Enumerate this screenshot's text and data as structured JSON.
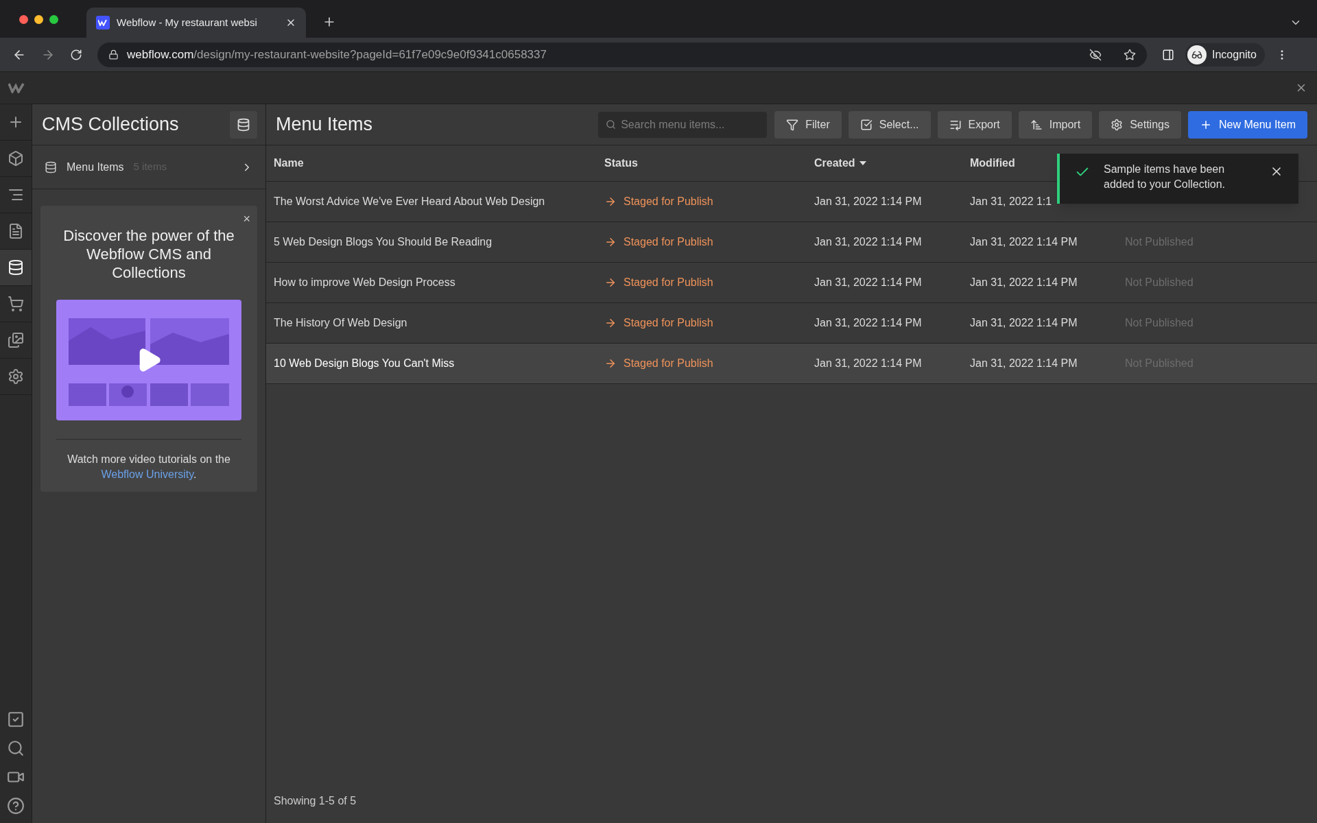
{
  "browser": {
    "tab_title": "Webflow - My restaurant websi",
    "url_host": "webflow.com",
    "url_path": "/design/my-restaurant-website?pageId=61f7e09c9e0f9341c0658337",
    "profile": "Incognito"
  },
  "rail": [
    {
      "kind": "add",
      "selected": false
    },
    {
      "kind": "box",
      "selected": false
    },
    {
      "kind": "navigator",
      "selected": false
    },
    {
      "kind": "pages",
      "selected": false
    },
    {
      "kind": "cms",
      "selected": true
    },
    {
      "kind": "cart",
      "selected": false
    },
    {
      "kind": "assets",
      "selected": false
    },
    {
      "kind": "settings",
      "selected": false
    }
  ],
  "rail_bottom": [
    {
      "kind": "check"
    },
    {
      "kind": "search"
    },
    {
      "kind": "video"
    },
    {
      "kind": "help"
    }
  ],
  "panel": {
    "title": "CMS Collections",
    "collections": [
      {
        "name": "Menu Items",
        "count": "5 items"
      }
    ],
    "promo": {
      "close": "×",
      "heading": "Discover the power of the Webflow CMS and Collections",
      "text": "Watch more video tutorials on the",
      "link": "Webflow University",
      "after": "."
    }
  },
  "main": {
    "title": "Menu Items",
    "search": {
      "placeholder": "Search menu items..."
    },
    "buttons": [
      {
        "kind": "filter",
        "label": "Filter"
      },
      {
        "kind": "select",
        "label": "Select..."
      },
      {
        "kind": "export",
        "label": "Export"
      },
      {
        "kind": "import",
        "label": "Import"
      },
      {
        "kind": "settings",
        "label": "Settings"
      },
      {
        "kind": "new",
        "label": "New Menu Item"
      }
    ],
    "table": {
      "columns": [
        {
          "label": "Name",
          "sorted": false
        },
        {
          "label": "Status",
          "sorted": false
        },
        {
          "label": "Created",
          "sorted": true
        },
        {
          "label": "Modified",
          "sorted": false
        }
      ],
      "rows": [
        {
          "name": "The Worst Advice We've Ever Heard About Web Design",
          "status": "Staged for Publish",
          "created": "Jan 31, 2022 1:14 PM",
          "modified": "Jan 31, 2022 1:1",
          "hovered": false
        },
        {
          "name": "5 Web Design Blogs You Should Be Reading",
          "status": "Staged for Publish",
          "created": "Jan 31, 2022 1:14 PM",
          "modified": "Jan 31, 2022 1:14 PM",
          "published": "Not Published",
          "hovered": false
        },
        {
          "name": "How to improve Web Design Process",
          "status": "Staged for Publish",
          "created": "Jan 31, 2022 1:14 PM",
          "modified": "Jan 31, 2022 1:14 PM",
          "published": "Not Published",
          "hovered": false
        },
        {
          "name": "The History Of Web Design",
          "status": "Staged for Publish",
          "created": "Jan 31, 2022 1:14 PM",
          "modified": "Jan 31, 2022 1:14 PM",
          "published": "Not Published",
          "hovered": false
        },
        {
          "name": "10 Web Design Blogs You Can't Miss",
          "status": "Staged for Publish",
          "created": "Jan 31, 2022 1:14 PM",
          "modified": "Jan 31, 2022 1:14 PM",
          "published": "Not Published",
          "hovered": true
        }
      ]
    },
    "footer": "Showing 1-5 of 5"
  },
  "toast": {
    "text": "Sample items have been added to your Collection."
  }
}
